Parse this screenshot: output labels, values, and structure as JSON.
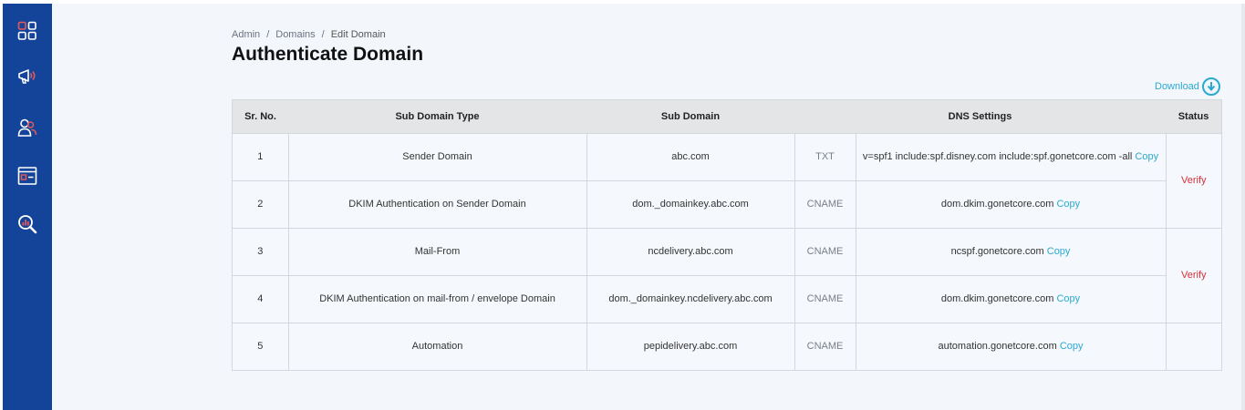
{
  "sidebar": {
    "icons": [
      "dashboard-icon",
      "megaphone-icon",
      "users-icon",
      "window-icon",
      "analytics-search-icon"
    ],
    "accent": "#e2595a",
    "background": "#14449a"
  },
  "breadcrumb": {
    "items": [
      "Admin",
      "Domains",
      "Edit Domain"
    ],
    "separator": "/"
  },
  "page": {
    "title": "Authenticate Domain"
  },
  "download": {
    "label": "Download",
    "icon": "download-circle-icon"
  },
  "table": {
    "headers": {
      "sr_no": "Sr. No.",
      "sub_domain_type": "Sub Domain Type",
      "sub_domain": "Sub Domain",
      "dns_settings": "DNS Settings",
      "status": "Status"
    },
    "rows": [
      {
        "sr": "1",
        "type": "Sender Domain",
        "sub_domain": "abc.com",
        "record": "TXT",
        "value": "v=spf1 include:spf.disney.com include:spf.gonetcore.com -all",
        "copy": "Copy"
      },
      {
        "sr": "2",
        "type": "DKIM Authentication on Sender Domain",
        "sub_domain": "dom._domainkey.abc.com",
        "record": "CNAME",
        "value": "dom.dkim.gonetcore.com",
        "copy": "Copy"
      },
      {
        "sr": "3",
        "type": "Mail-From",
        "sub_domain": "ncdelivery.abc.com",
        "record": "CNAME",
        "value": "ncspf.gonetcore.com",
        "copy": "Copy"
      },
      {
        "sr": "4",
        "type": "DKIM Authentication on mail-from / envelope Domain",
        "sub_domain": "dom._domainkey.ncdelivery.abc.com",
        "record": "CNAME",
        "value": "dom.dkim.gonetcore.com",
        "copy": "Copy"
      },
      {
        "sr": "5",
        "type": "Automation",
        "sub_domain": "pepidelivery.abc.com",
        "record": "CNAME",
        "value": "automation.gonetcore.com",
        "copy": "Copy"
      }
    ],
    "status": [
      "Verify",
      "Verify"
    ]
  }
}
